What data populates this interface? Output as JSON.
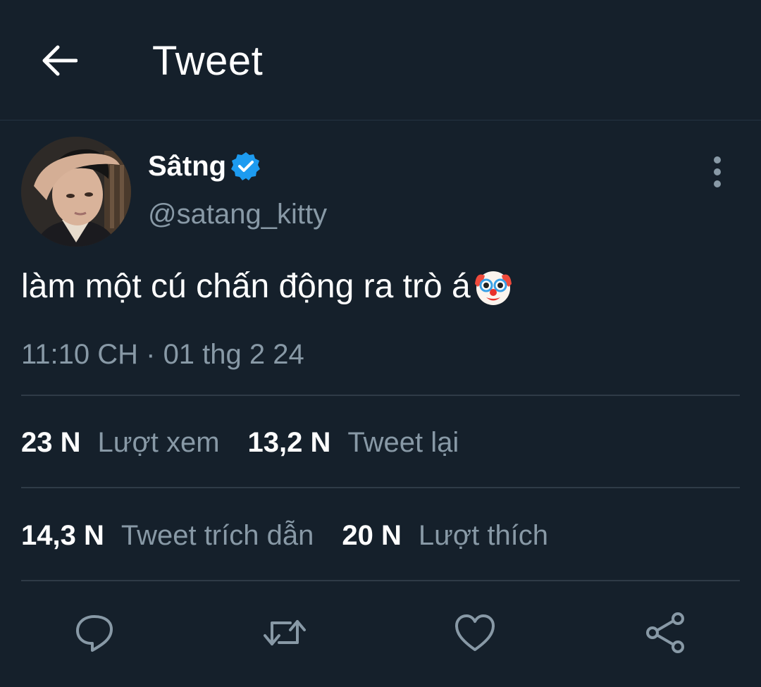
{
  "header": {
    "title": "Tweet",
    "back_icon": "arrow-left-icon"
  },
  "tweet": {
    "author_name": "Sâtng",
    "handle": "@satang_kitty",
    "verified": true,
    "text": "làm một cú chấn động ra trò á",
    "emoji": "clown-face-emoji",
    "timestamp": "11:10 CH · 01 thg 2 24"
  },
  "stats": {
    "views": {
      "count": "23 N",
      "label": "Lượt xem"
    },
    "retweets": {
      "count": "13,2 N",
      "label": "Tweet lại"
    },
    "quotes": {
      "count": "14,3 N",
      "label": "Tweet trích dẫn"
    },
    "likes": {
      "count": "20 N",
      "label": "Lượt thích"
    }
  },
  "actions": [
    "reply-icon",
    "retweet-icon",
    "like-icon",
    "share-icon"
  ],
  "colors": {
    "background": "#15202b",
    "secondary_text": "#8899a6",
    "verified_blue": "#1d9bf0",
    "divider": "#2f3b47"
  }
}
